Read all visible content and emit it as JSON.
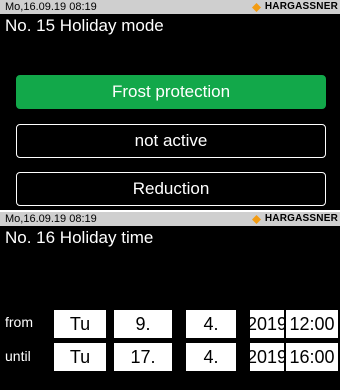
{
  "brand": {
    "name": "HARGASSNER",
    "accent": "#f39c12",
    "icon": "diamond-logo-icon"
  },
  "colors": {
    "selected_option": "#12a84a",
    "screen_bg": "#000000",
    "status_bar": "#cfcfcf"
  },
  "screen1": {
    "datetime": "Mo,16.09.19 08:19",
    "title": "No. 15 Holiday mode",
    "options": [
      {
        "label": "Frost protection",
        "selected": true
      },
      {
        "label": "not active",
        "selected": false
      },
      {
        "label": "Reduction",
        "selected": false
      }
    ]
  },
  "screen2": {
    "datetime": "Mo,16.09.19 08:19",
    "title": "No. 16 Holiday time",
    "rows": [
      {
        "label": "from",
        "fields": [
          "Tu",
          "9.",
          "4.",
          "2019",
          "12:00"
        ]
      },
      {
        "label": "until",
        "fields": [
          "Tu",
          "17.",
          "4.",
          "2019",
          "16:00"
        ]
      }
    ]
  }
}
